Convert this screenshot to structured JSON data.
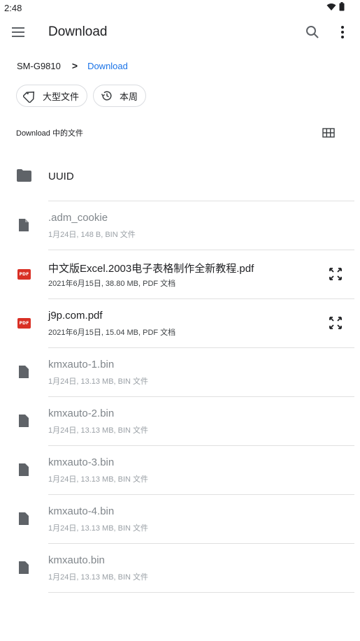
{
  "status_bar": {
    "time": "2:48"
  },
  "app_bar": {
    "title": "Download"
  },
  "breadcrumb": {
    "root": "SM-G9810",
    "separator": ">",
    "current": "Download"
  },
  "chips": [
    {
      "label": "大型文件",
      "icon": "label-icon"
    },
    {
      "label": "本周",
      "icon": "history-icon"
    }
  ],
  "section": {
    "label": "Download 中的文件"
  },
  "folders": [
    {
      "name": "UUID"
    }
  ],
  "files": [
    {
      "name": ".adm_cookie",
      "meta": "1月24日, 148 B, BIN 文件",
      "type": "bin",
      "dim": true
    },
    {
      "name": "中文版Excel.2003电子表格制作全新教程.pdf",
      "meta": "2021年6月15日, 38.80 MB, PDF 文档",
      "type": "pdf",
      "dim": false
    },
    {
      "name": "j9p.com.pdf",
      "meta": "2021年6月15日, 15.04 MB, PDF 文档",
      "type": "pdf",
      "dim": false
    },
    {
      "name": "kmxauto-1.bin",
      "meta": "1月24日, 13.13 MB, BIN 文件",
      "type": "bin",
      "dim": true
    },
    {
      "name": "kmxauto-2.bin",
      "meta": "1月24日, 13.13 MB, BIN 文件",
      "type": "bin",
      "dim": true
    },
    {
      "name": "kmxauto-3.bin",
      "meta": "1月24日, 13.13 MB, BIN 文件",
      "type": "bin",
      "dim": true
    },
    {
      "name": "kmxauto-4.bin",
      "meta": "1月24日, 13.13 MB, BIN 文件",
      "type": "bin",
      "dim": true
    },
    {
      "name": "kmxauto.bin",
      "meta": "1月24日, 13.13 MB, BIN 文件",
      "type": "bin",
      "dim": true
    }
  ],
  "pdf_badge_text": "PDF",
  "colors": {
    "accent": "#1a73e8",
    "pdf": "#d93025",
    "icon": "#5f6368"
  }
}
